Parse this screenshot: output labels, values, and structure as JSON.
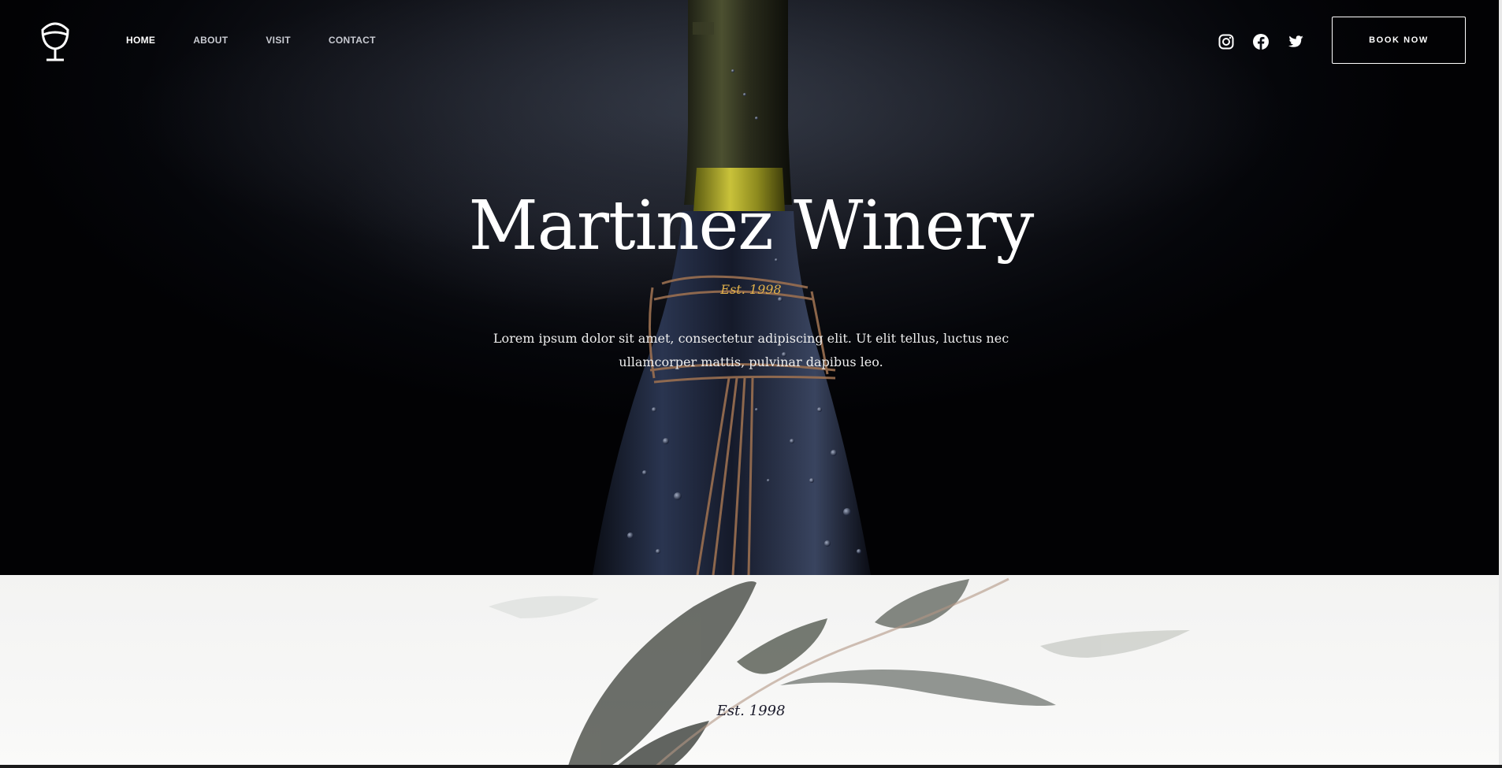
{
  "brand": {
    "logo_icon": "wine-glass-icon"
  },
  "nav": {
    "items": [
      {
        "label": "HOME",
        "active": true
      },
      {
        "label": "ABOUT",
        "active": false
      },
      {
        "label": "VISIT",
        "active": false
      },
      {
        "label": "CONTACT",
        "active": false
      }
    ]
  },
  "social": {
    "icons": [
      "instagram-icon",
      "facebook-icon",
      "twitter-icon"
    ]
  },
  "header": {
    "book_label": "BOOK NOW"
  },
  "hero": {
    "title": "Martinez Winery",
    "est": "Est. 1998",
    "description": "Lorem ipsum dolor sit amet, consectetur adipiscing elit. Ut elit tellus, luctus nec ullamcorper mattis, pulvinar dapibus leo."
  },
  "intro": {
    "est": "Est. 1998"
  },
  "colors": {
    "accent_gold": "#e0b04a",
    "hero_bg": "#05060a",
    "lower_bg": "#f5f5f4"
  }
}
